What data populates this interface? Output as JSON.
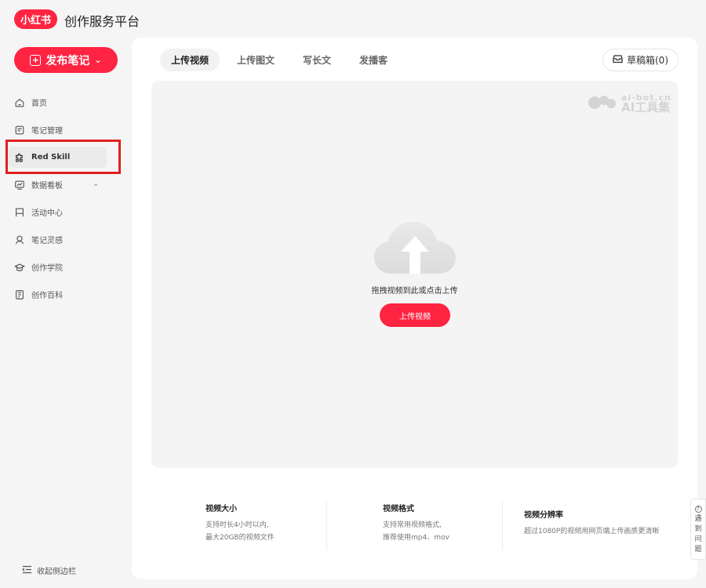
{
  "header": {
    "logo": "小红书",
    "title": "创作服务平台"
  },
  "sidebar": {
    "publish_label": "发布笔记",
    "items": [
      {
        "label": "首页",
        "icon": "home-icon"
      },
      {
        "label": "笔记管理",
        "icon": "notes-icon"
      },
      {
        "label": "Red Skill",
        "icon": "puzzle-icon",
        "active": true
      },
      {
        "label": "数据看板",
        "icon": "chart-icon",
        "expandable": true
      },
      {
        "label": "活动中心",
        "icon": "flag-icon"
      },
      {
        "label": "笔记灵感",
        "icon": "inspiration-icon"
      },
      {
        "label": "创作学院",
        "icon": "graduation-icon"
      },
      {
        "label": "创作百科",
        "icon": "book-icon"
      }
    ],
    "collapse_label": "收起侧边栏"
  },
  "main": {
    "tabs": [
      {
        "label": "上传视频",
        "active": true
      },
      {
        "label": "上传图文"
      },
      {
        "label": "写长文"
      },
      {
        "label": "发播客"
      }
    ],
    "drafts_label": "草稿箱(0)",
    "watermark": {
      "domain": "ai-bot.cn",
      "name": "AI工具集"
    },
    "upload": {
      "hint": "拖拽视频到此或点击上传",
      "button": "上传视频"
    },
    "info": [
      {
        "title": "视频大小",
        "lines": [
          "支持时长4小时以内,",
          "最大20GB的视频文件"
        ]
      },
      {
        "title": "视频格式",
        "lines": [
          "支持常用视频格式,",
          "推荐使用mp4、mov"
        ]
      },
      {
        "title": "视频分辨率",
        "lines": [
          "超过1080P的视频用网页端上传画质更清晰"
        ]
      }
    ]
  },
  "feedback": {
    "label": [
      "遇",
      "到",
      "问",
      "题"
    ]
  },
  "colors": {
    "brand": "#ff2442",
    "highlight": "#e02020"
  }
}
